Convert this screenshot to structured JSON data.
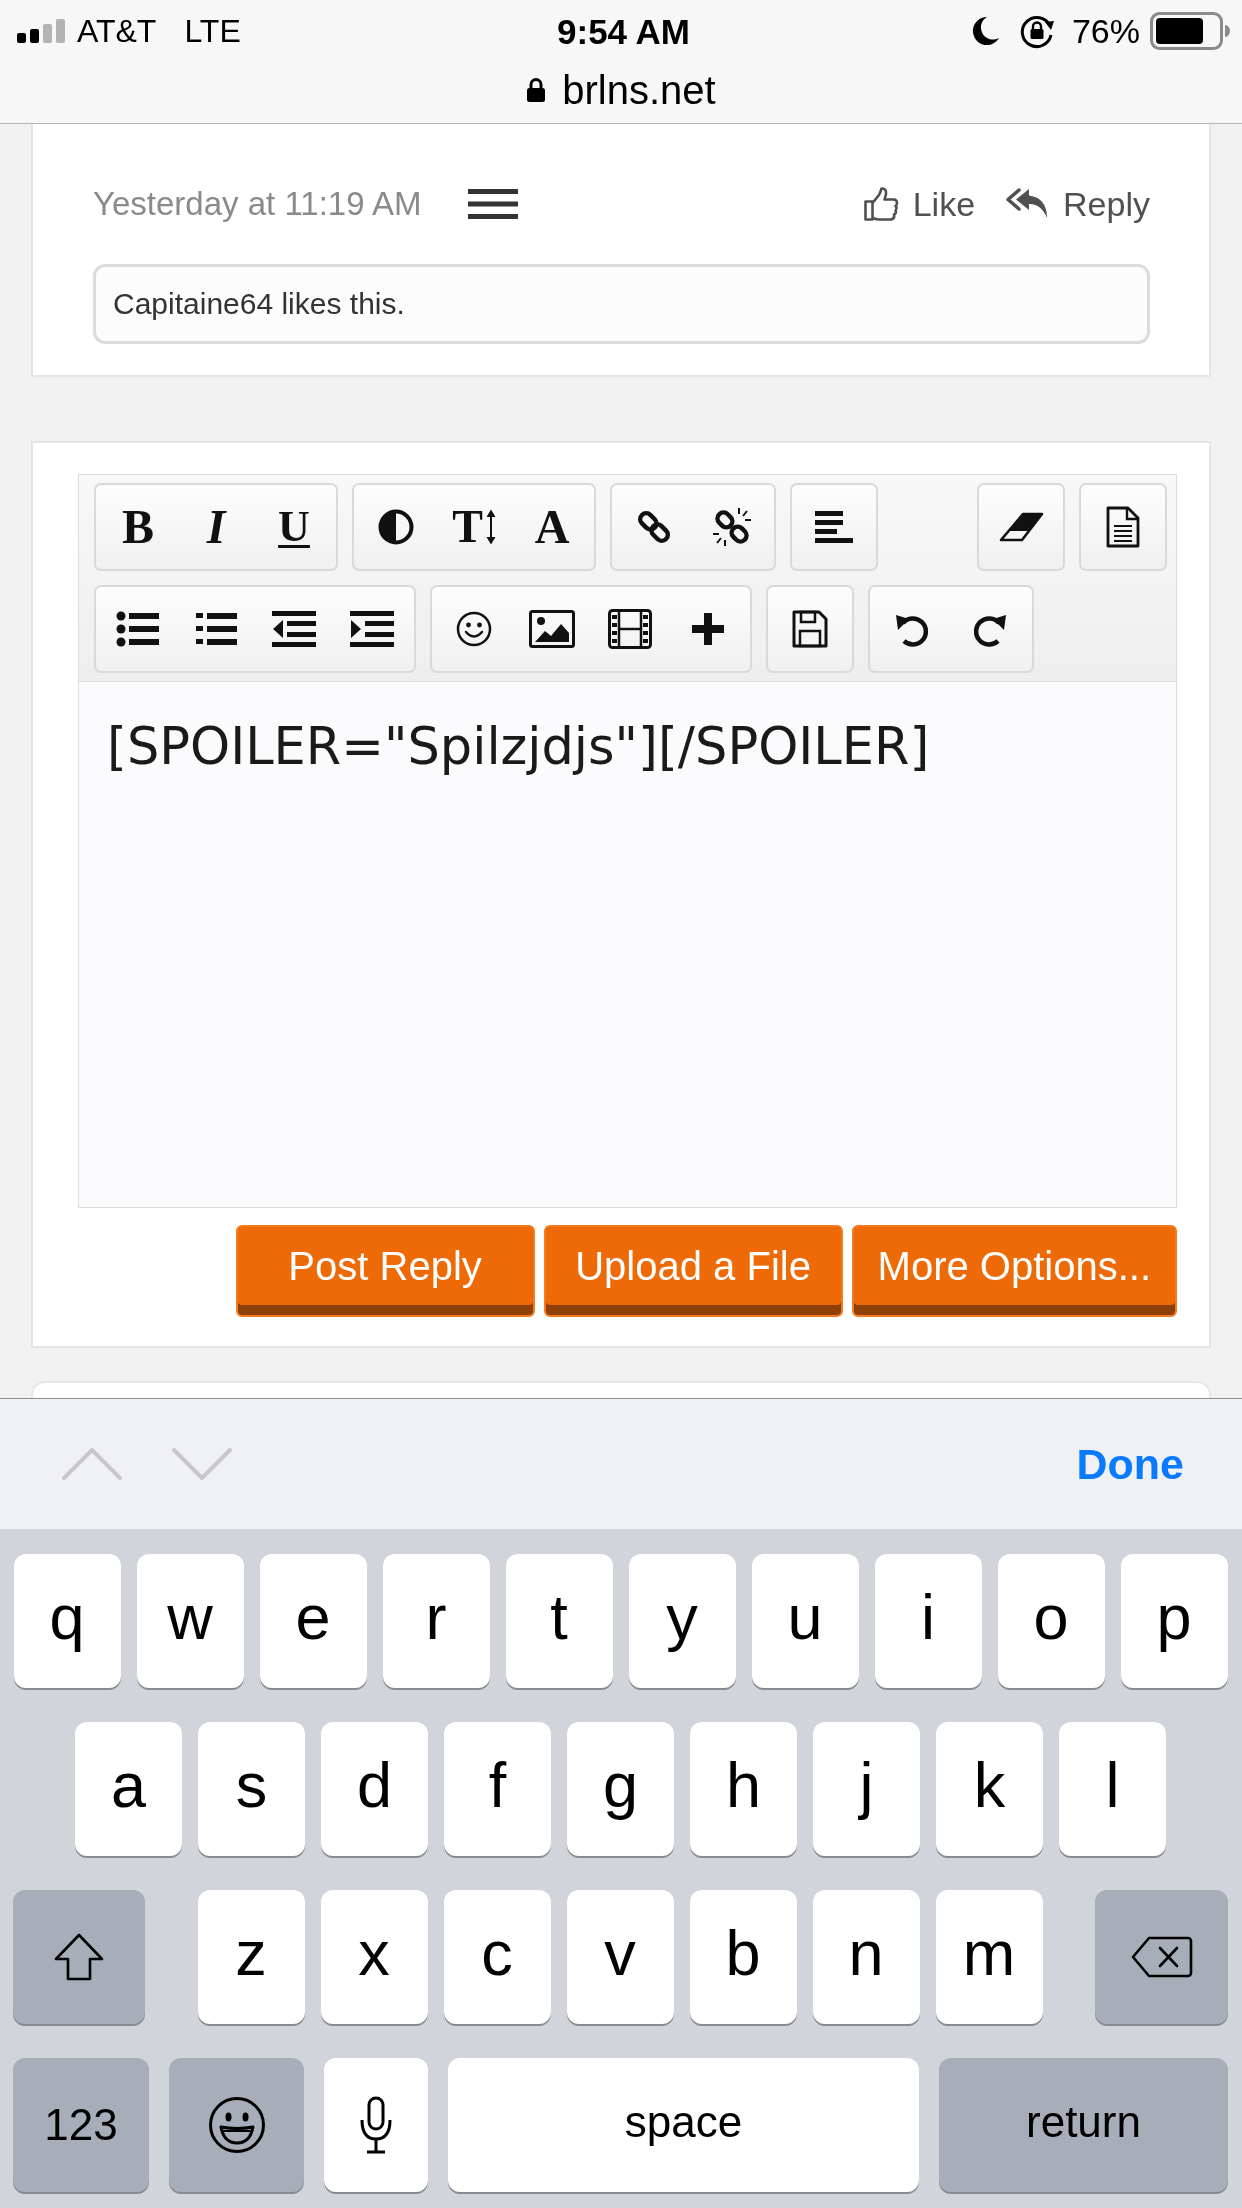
{
  "status_bar": {
    "carrier": "AT&T",
    "network": "LTE",
    "time": "9:54 AM",
    "battery": "76%",
    "url": "brlns.net"
  },
  "post": {
    "timestamp": "Yesterday at 11:19 AM",
    "actions": [
      {
        "kind": "like",
        "label": "Like"
      },
      {
        "kind": "reply",
        "label": "Reply"
      }
    ],
    "likes": "Capitaine64 likes this."
  },
  "editor": {
    "toolbar": [
      {
        "groups": [
          {
            "buttons": [
              {
                "kind": "bold",
                "glyph": "B"
              },
              {
                "kind": "italic",
                "glyph": "I"
              },
              {
                "kind": "underline",
                "glyph": "U"
              }
            ]
          },
          {
            "buttons": [
              {
                "kind": "color"
              },
              {
                "kind": "font-size",
                "glyph": "T"
              },
              {
                "kind": "font",
                "glyph": "A"
              }
            ]
          },
          {
            "buttons": [
              {
                "kind": "link"
              },
              {
                "kind": "unlink"
              }
            ]
          },
          {
            "buttons": [
              {
                "kind": "align"
              }
            ]
          },
          {
            "buttons": [
              {
                "kind": "remove-format"
              }
            ]
          },
          {
            "buttons": [
              {
                "kind": "template"
              }
            ]
          }
        ]
      },
      {
        "groups": [
          {
            "buttons": [
              {
                "kind": "bullet-list"
              },
              {
                "kind": "numbered-list"
              },
              {
                "kind": "outdent"
              },
              {
                "kind": "indent"
              }
            ]
          },
          {
            "buttons": [
              {
                "kind": "smilie"
              },
              {
                "kind": "image"
              },
              {
                "kind": "media"
              },
              {
                "kind": "insert"
              }
            ]
          },
          {
            "buttons": [
              {
                "kind": "draft"
              }
            ]
          },
          {
            "buttons": [
              {
                "kind": "undo"
              },
              {
                "kind": "redo"
              }
            ]
          }
        ]
      }
    ],
    "value": "[SPOILER=\"Spilzjdjs\"][/SPOILER]",
    "buttons": [
      "Post Reply",
      "Upload a File",
      "More Options..."
    ]
  },
  "accessory_bar": {
    "arrows": [
      {
        "kind": "up",
        "disabled": true
      },
      {
        "kind": "down",
        "disabled": true
      }
    ],
    "done": "Done"
  },
  "keyboard": {
    "rows": [
      {
        "keys": [
          {
            "kind": "letter",
            "label": "q"
          },
          {
            "kind": "letter",
            "label": "w"
          },
          {
            "kind": "letter",
            "label": "e"
          },
          {
            "kind": "letter",
            "label": "r"
          },
          {
            "kind": "letter",
            "label": "t"
          },
          {
            "kind": "letter",
            "label": "y"
          },
          {
            "kind": "letter",
            "label": "u"
          },
          {
            "kind": "letter",
            "label": "i"
          },
          {
            "kind": "letter",
            "label": "o"
          },
          {
            "kind": "letter",
            "label": "p"
          }
        ]
      },
      {
        "keys": [
          {
            "kind": "letter",
            "label": "a"
          },
          {
            "kind": "letter",
            "label": "s"
          },
          {
            "kind": "letter",
            "label": "d"
          },
          {
            "kind": "letter",
            "label": "f"
          },
          {
            "kind": "letter",
            "label": "g"
          },
          {
            "kind": "letter",
            "label": "h"
          },
          {
            "kind": "letter",
            "label": "j"
          },
          {
            "kind": "letter",
            "label": "k"
          },
          {
            "kind": "letter",
            "label": "l"
          }
        ]
      },
      {
        "keys": [
          {
            "kind": "shift"
          },
          {
            "kind": "letter",
            "label": "z"
          },
          {
            "kind": "letter",
            "label": "x"
          },
          {
            "kind": "letter",
            "label": "c"
          },
          {
            "kind": "letter",
            "label": "v"
          },
          {
            "kind": "letter",
            "label": "b"
          },
          {
            "kind": "letter",
            "label": "n"
          },
          {
            "kind": "letter",
            "label": "m"
          },
          {
            "kind": "delete"
          }
        ]
      },
      {
        "keys": [
          {
            "kind": "numbers",
            "label": "123"
          },
          {
            "kind": "emoji"
          },
          {
            "kind": "dictation"
          },
          {
            "kind": "space",
            "label": "space"
          },
          {
            "kind": "return",
            "label": "return"
          }
        ]
      }
    ]
  }
}
